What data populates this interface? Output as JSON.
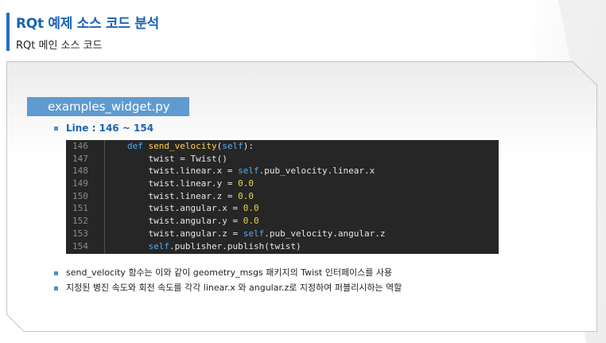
{
  "header": {
    "title": "RQt 예제 소스 코드 분석",
    "subtitle": "RQt 메인 소스 코드"
  },
  "content": {
    "file_name": "examples_widget.py",
    "line_range_label": "Line : 146 ~ 154",
    "code_lines": [
      {
        "num": "146",
        "text": "    def send_velocity(self):"
      },
      {
        "num": "147",
        "text": "        twist = Twist()"
      },
      {
        "num": "148",
        "text": "        twist.linear.x = self.pub_velocity.linear.x"
      },
      {
        "num": "149",
        "text": "        twist.linear.y = 0.0"
      },
      {
        "num": "150",
        "text": "        twist.linear.z = 0.0"
      },
      {
        "num": "151",
        "text": "        twist.angular.x = 0.0"
      },
      {
        "num": "152",
        "text": "        twist.angular.y = 0.0"
      },
      {
        "num": "153",
        "text": "        twist.angular.z = self.pub_velocity.angular.z"
      },
      {
        "num": "154",
        "text": "        self.publisher.publish(twist)"
      }
    ],
    "notes": [
      "send_velocity 함수는 이와 같이 geometry_msgs 패키지의 Twist 인터페이스를 사용",
      "지정된 병진 속도와 회전 속도를 각각 linear.x 와 angular.z로 지정하여 퍼블리시하는 역할"
    ]
  },
  "colors": {
    "accent": "#1a63b5",
    "tab": "#5f9bd0",
    "code_bg": "#262626"
  }
}
